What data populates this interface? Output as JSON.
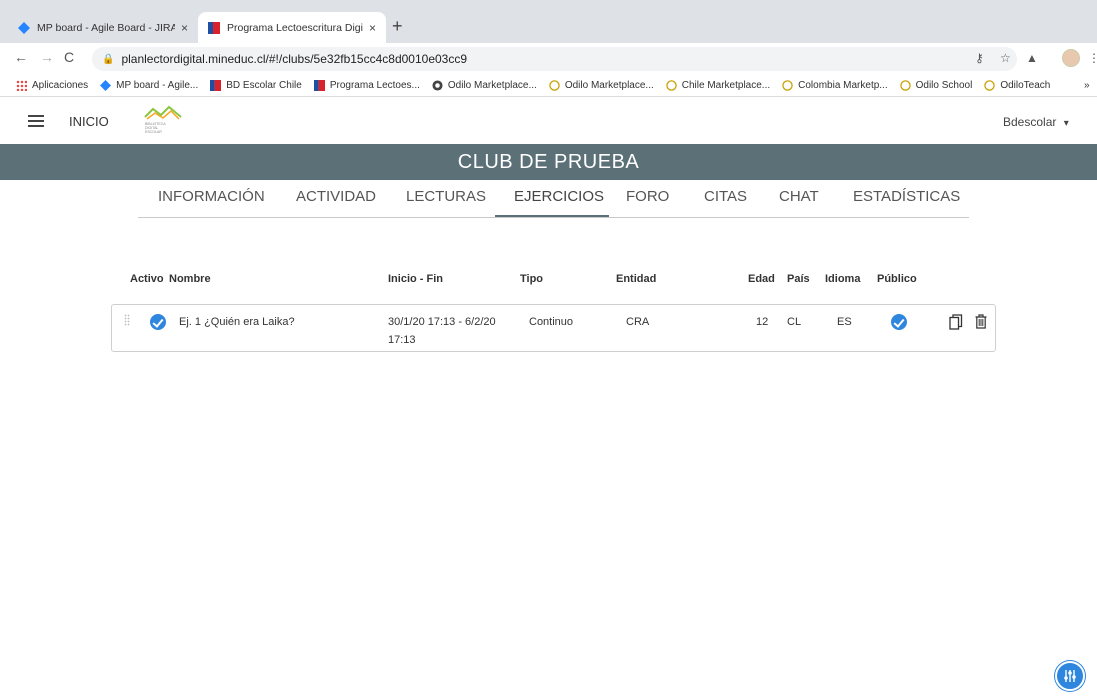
{
  "browser": {
    "tabs": [
      {
        "title": "MP board - Agile Board - JIRA",
        "close": "×"
      },
      {
        "title": "Programa Lectoescritura Digita",
        "close": "×"
      }
    ],
    "new_tab": "+",
    "url": "planlectordigital.mineduc.cl/#!/clubs/5e32fb15cc4c8d0010e03cc9",
    "bookmarks": [
      {
        "label": "Aplicaciones",
        "icon": "apps-grid-icon"
      },
      {
        "label": "MP board - Agile...",
        "icon": "jira-icon"
      },
      {
        "label": "BD Escolar Chile",
        "icon": "flag-icon"
      },
      {
        "label": "Programa Lectoes...",
        "icon": "flag-icon"
      },
      {
        "label": "Odilo Marketplace...",
        "icon": "globe-icon"
      },
      {
        "label": "Odilo Marketplace...",
        "icon": "circle-icon"
      },
      {
        "label": "Chile Marketplace...",
        "icon": "circle-icon"
      },
      {
        "label": "Colombia Marketp...",
        "icon": "circle-icon"
      },
      {
        "label": "Odilo School",
        "icon": "circle-icon"
      },
      {
        "label": "OdiloTeach",
        "icon": "circle-icon"
      }
    ],
    "bookmarks_overflow": "»"
  },
  "header": {
    "menu_label": "INICIO",
    "user": "Bdescolar",
    "club_title": "CLUB DE PRUEBA",
    "logo_text": [
      "BIBLIOTECA",
      "DIGITAL",
      "ESCOLAR"
    ]
  },
  "nav": {
    "tabs": [
      "INFORMACIÓN",
      "ACTIVIDAD",
      "LECTURAS",
      "EJERCICIOS",
      "FORO",
      "CITAS",
      "CHAT",
      "ESTADÍSTICAS"
    ],
    "active": "EJERCICIOS"
  },
  "table": {
    "headers": {
      "activo": "Activo",
      "nombre": "Nombre",
      "inicio_fin": "Inicio - Fin",
      "tipo": "Tipo",
      "entidad": "Entidad",
      "edad": "Edad",
      "pais": "País",
      "idioma": "Idioma",
      "publico": "Público"
    },
    "rows": [
      {
        "activo": true,
        "nombre": "Ej. 1 ¿Quién era Laika?",
        "inicio_fin_1": "30/1/20 17:13 - 6/2/20",
        "inicio_fin_2": "17:13",
        "tipo": "Continuo",
        "entidad": "CRA",
        "edad": "12",
        "pais": "CL",
        "idioma": "ES",
        "publico": true
      }
    ]
  },
  "colors": {
    "band": "#5b7077",
    "accent": "#2e86de",
    "tab_underline": "#5b7077"
  }
}
